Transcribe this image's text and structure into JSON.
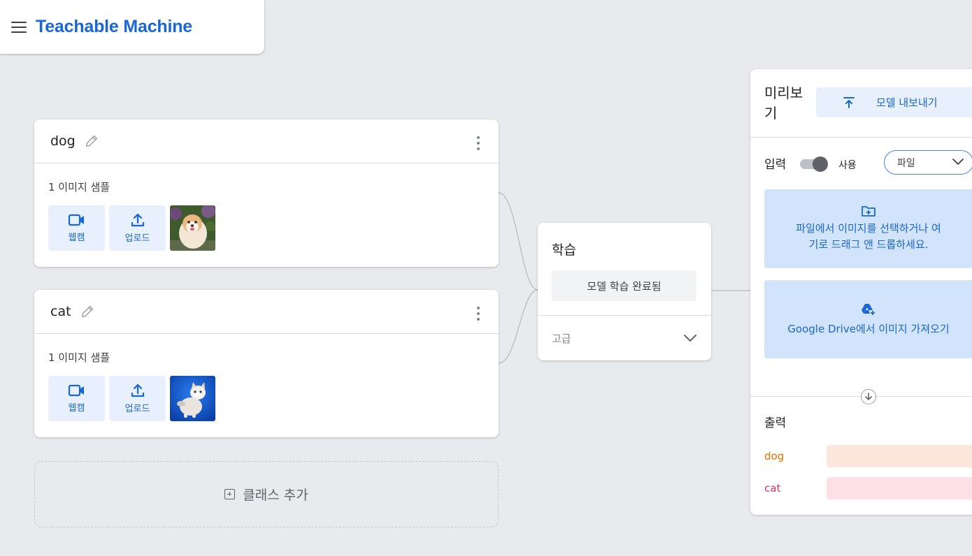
{
  "app": {
    "title": "Teachable Machine"
  },
  "classes": [
    {
      "name": "dog",
      "samples_label": "1 이미지 샘플",
      "webcam_label": "웹캠",
      "upload_label": "업로드"
    },
    {
      "name": "cat",
      "samples_label": "1 이미지 샘플",
      "webcam_label": "웹캠",
      "upload_label": "업로드"
    }
  ],
  "add_class_label": "클래스 추가",
  "training": {
    "title": "학습",
    "button_label": "모델 학습 완료됨",
    "advanced_label": "고급"
  },
  "preview": {
    "title": "미리보기",
    "export_label": "모델 내보내기",
    "input_label": "입력",
    "toggle_label": "사용",
    "toggle_on": true,
    "source_selected": "파일",
    "drop_text": "파일에서 이미지를 선택하거나 여기로 드래그 앤 드롭하세요.",
    "gdrive_text": "Google Drive에서 이미지 가져오기",
    "output_label": "출력",
    "outputs": [
      {
        "name": "dog",
        "color": "#e37400",
        "bar_color": "#fde7dc"
      },
      {
        "name": "cat",
        "color": "#d93065",
        "bar_color": "#fde0e6"
      }
    ]
  },
  "colors": {
    "accent": "#1967d2",
    "tile_bg": "#e8f0fe",
    "drop_bg": "#d2e3fc"
  }
}
